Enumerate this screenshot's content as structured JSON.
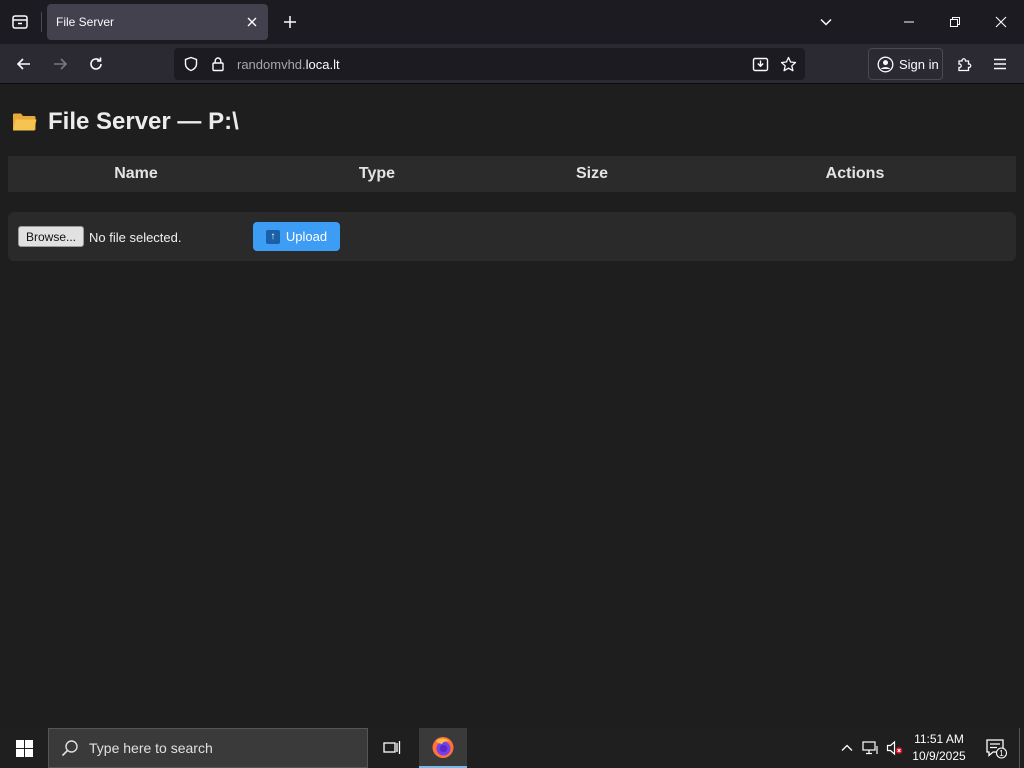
{
  "browser": {
    "tab_title": "File Server",
    "url_prefix": "randomvhd.",
    "url_host": "loca.lt",
    "signin_label": "Sign in"
  },
  "page": {
    "title": "File Server — P:\\",
    "table_headers": [
      "Name",
      "Type",
      "Size",
      "Actions"
    ],
    "rows": [],
    "browse_label": "Browse...",
    "file_status": "No file selected.",
    "upload_label": "Upload"
  },
  "taskbar": {
    "search_placeholder": "Type here to search",
    "time": "11:51 AM",
    "date": "10/9/2025",
    "notification_count": "1"
  },
  "colors": {
    "accent": "#3d9df5",
    "folder": "#f5c451",
    "page_bg": "#1e1e1e"
  }
}
